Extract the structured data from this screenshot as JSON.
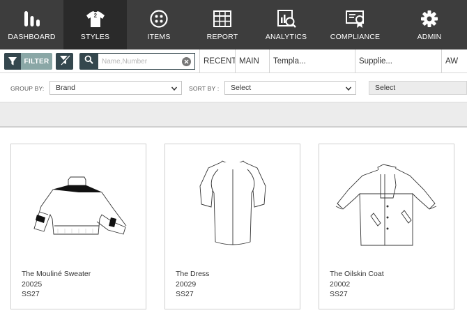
{
  "nav": {
    "items": [
      {
        "label": "DASHBOARD",
        "icon": "bar-chart-icon"
      },
      {
        "label": "STYLES",
        "icon": "shirt-icon",
        "badge": "2"
      },
      {
        "label": "ITEMS",
        "icon": "button-icon"
      },
      {
        "label": "REPORT",
        "icon": "table-icon"
      },
      {
        "label": "ANALYTICS",
        "icon": "analytics-icon"
      },
      {
        "label": "COMPLIANCE",
        "icon": "certificate-icon"
      },
      {
        "label": "ADMIN",
        "icon": "gear-icon"
      }
    ]
  },
  "filterbar": {
    "filter_label": "FILTER",
    "search_placeholder": "Name,Number",
    "tabs": [
      "RECENT",
      "MAIN",
      "Templa...",
      "Supplie...",
      "AW"
    ]
  },
  "groupbar": {
    "group_by_label": "GROUP BY:",
    "group_by_value": "Brand",
    "sort_by_label": "SORT BY :",
    "sort_by_value": "Select",
    "third_select_value": "Select"
  },
  "styles": [
    {
      "name": "The Mouliné Sweater",
      "number": "20025",
      "season": "SS27",
      "icon": "sweater-sketch"
    },
    {
      "name": "The Dress",
      "number": "20029",
      "season": "SS27",
      "icon": "dress-sketch"
    },
    {
      "name": "The Oilskin Coat",
      "number": "20002",
      "season": "SS27",
      "icon": "coat-sketch"
    }
  ],
  "colors": {
    "nav_bg": "#3d3d3d",
    "nav_active_bg": "#2a2a2a",
    "accent_dark": "#34474e",
    "accent_teal": "#8aa7a6"
  }
}
